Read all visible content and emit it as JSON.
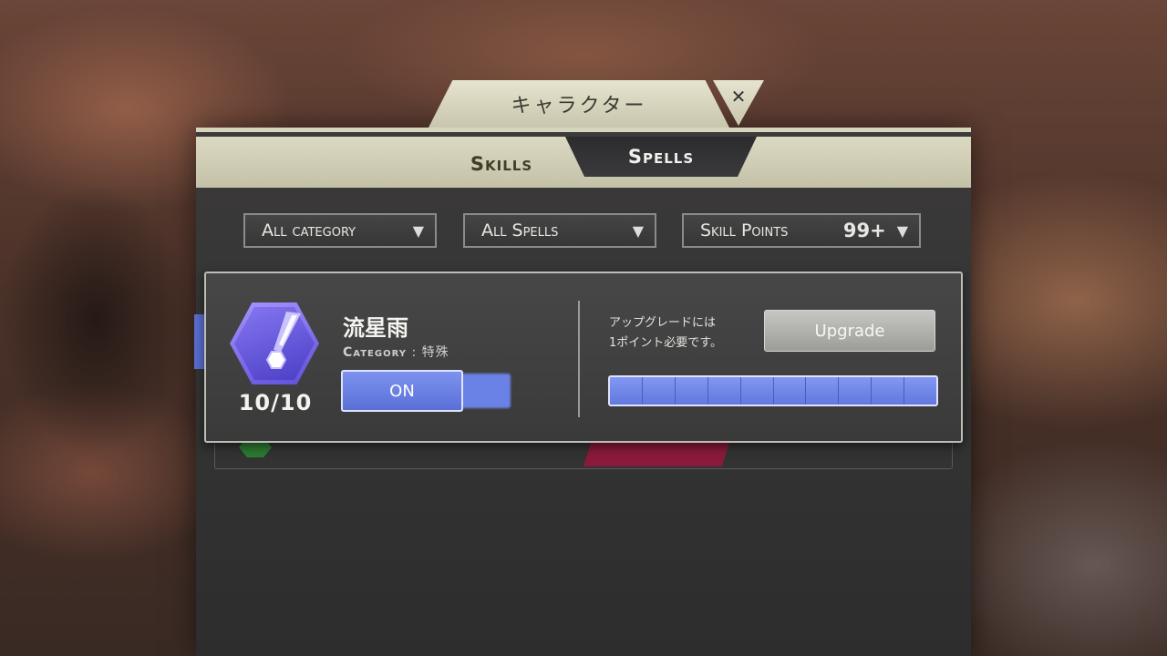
{
  "window": {
    "title": "キャラクター",
    "close_label": "✕"
  },
  "tabs": [
    {
      "label": "Skills",
      "active": false
    },
    {
      "label": "Spells",
      "active": true
    }
  ],
  "filters": {
    "category": "All category",
    "type": "All Spells",
    "skill_points_label": "Skill Points",
    "skill_points_value": "99+"
  },
  "spell": {
    "name": "流星雨",
    "category_key": "Category",
    "category_value": "特殊",
    "level": "10/10",
    "toggle_label": "ON",
    "toggle_on": true,
    "upgrade_note_line1": "アップグレードには",
    "upgrade_note_line2": "1ポイント必要です。",
    "upgrade_button": "Upgrade",
    "progress": {
      "filled": 10,
      "total": 10
    }
  },
  "colors": {
    "accent": "#6a82e6",
    "panel": "#353535",
    "trim": "#d8d5bf",
    "spell_icon": "#7a6cf0"
  }
}
